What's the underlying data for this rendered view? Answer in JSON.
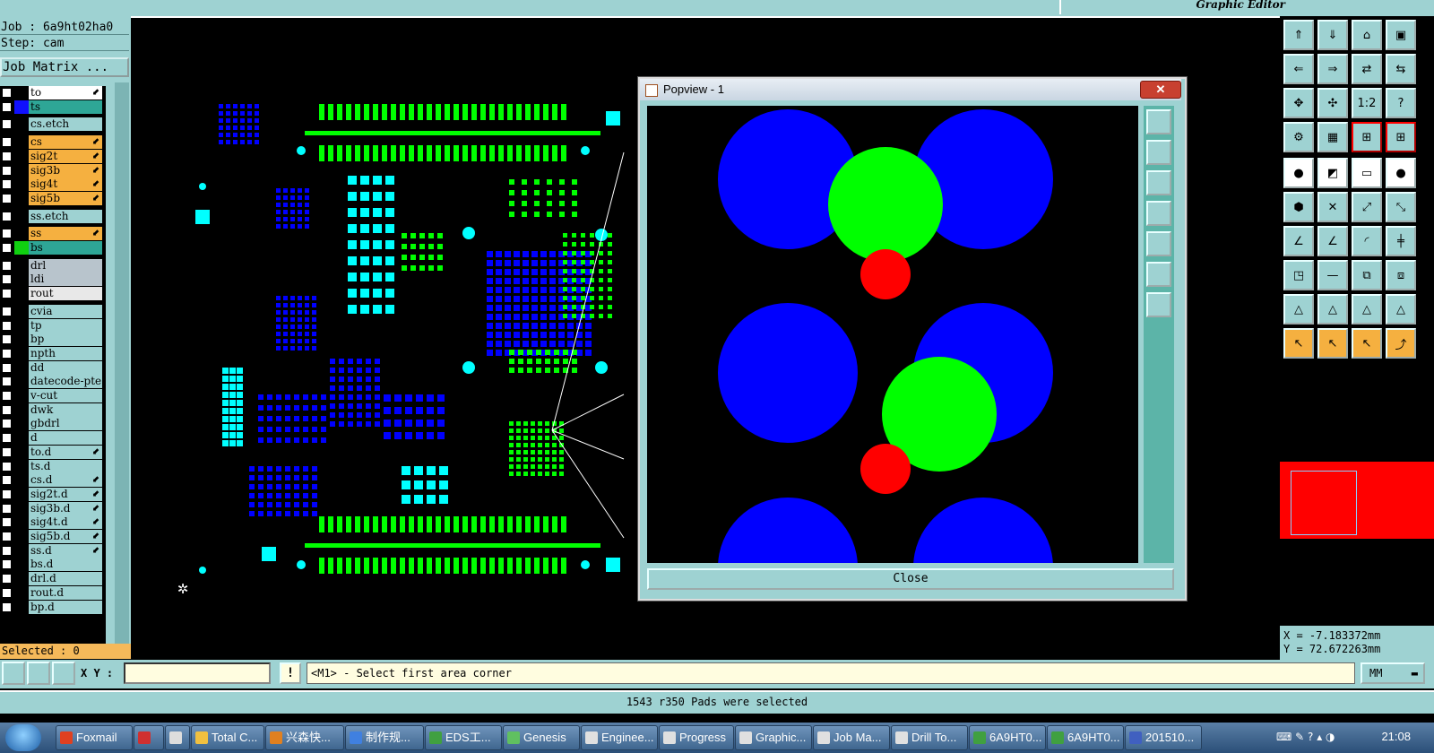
{
  "app": {
    "subtitle": "Graphic Editor"
  },
  "job": {
    "job_line": "Job : 6a9ht02ha0",
    "step_line": "Step: cam",
    "matrix_button": "Job Matrix ..."
  },
  "layers": [
    {
      "name": "to",
      "color": "#ffffff",
      "bg": "#ffffff",
      "flag": "⬋",
      "swatch": "#000000"
    },
    {
      "name": "ts",
      "color": "#2ea696",
      "bg": "#2ea696",
      "flag": "",
      "swatch": "#1010ff"
    },
    {
      "name": "cs.etch",
      "color": "#9ed2d2",
      "bg": "#9ed2d2",
      "flag": "",
      "swatch": "#000000"
    },
    {
      "name": "cs",
      "color": "#f5b040",
      "bg": "#f5b040",
      "flag": "⬋",
      "swatch": "#000000"
    },
    {
      "name": "sig2t",
      "color": "#f5b040",
      "bg": "#f5b040",
      "flag": "⬋",
      "swatch": "#000000"
    },
    {
      "name": "sig3b",
      "color": "#f5b040",
      "bg": "#f5b040",
      "flag": "⬋",
      "swatch": "#000000"
    },
    {
      "name": "sig4t",
      "color": "#f5b040",
      "bg": "#f5b040",
      "flag": "⬋",
      "swatch": "#000000"
    },
    {
      "name": "sig5b",
      "color": "#f5b040",
      "bg": "#f5b040",
      "flag": "⬋",
      "swatch": "#000000"
    },
    {
      "name": "ss.etch",
      "color": "#9ed2d2",
      "bg": "#9ed2d2",
      "flag": "",
      "swatch": "#000000"
    },
    {
      "name": "ss",
      "color": "#f5b040",
      "bg": "#f5b040",
      "flag": "⬋",
      "swatch": "#000000"
    },
    {
      "name": "bs",
      "color": "#2ea696",
      "bg": "#2ea696",
      "flag": "",
      "swatch": "#10d010"
    },
    {
      "name": "drl",
      "color": "#b8c4cc",
      "bg": "#b8c4cc",
      "flag": "",
      "swatch": "#000000"
    },
    {
      "name": "ldi",
      "color": "#b8c4cc",
      "bg": "#b8c4cc",
      "flag": "",
      "swatch": "#000000"
    },
    {
      "name": "rout",
      "color": "#e8e8e8",
      "bg": "#e8e8e8",
      "flag": "",
      "swatch": "#000000"
    },
    {
      "name": "cvia",
      "color": "#9ed2d2",
      "bg": "#9ed2d2",
      "flag": "",
      "swatch": "#000000"
    },
    {
      "name": "tp",
      "color": "#9ed2d2",
      "bg": "#9ed2d2",
      "flag": "",
      "swatch": "#000000"
    },
    {
      "name": "bp",
      "color": "#9ed2d2",
      "bg": "#9ed2d2",
      "flag": "",
      "swatch": "#000000"
    },
    {
      "name": "npth",
      "color": "#9ed2d2",
      "bg": "#9ed2d2",
      "flag": "",
      "swatch": "#000000"
    },
    {
      "name": "dd",
      "color": "#9ed2d2",
      "bg": "#9ed2d2",
      "flag": "",
      "swatch": "#000000"
    },
    {
      "name": "datecode-pte",
      "color": "#9ed2d2",
      "bg": "#9ed2d2",
      "flag": "",
      "swatch": "#000000"
    },
    {
      "name": "v-cut",
      "color": "#9ed2d2",
      "bg": "#9ed2d2",
      "flag": "",
      "swatch": "#000000"
    },
    {
      "name": "dwk",
      "color": "#9ed2d2",
      "bg": "#9ed2d2",
      "flag": "",
      "swatch": "#000000"
    },
    {
      "name": "gbdrl",
      "color": "#9ed2d2",
      "bg": "#9ed2d2",
      "flag": "",
      "swatch": "#000000"
    },
    {
      "name": "d",
      "color": "#9ed2d2",
      "bg": "#9ed2d2",
      "flag": "",
      "swatch": "#000000"
    },
    {
      "name": "to.d",
      "color": "#9ed2d2",
      "bg": "#9ed2d2",
      "flag": "⬋",
      "swatch": "#000000"
    },
    {
      "name": "ts.d",
      "color": "#9ed2d2",
      "bg": "#9ed2d2",
      "flag": "",
      "swatch": "#000000"
    },
    {
      "name": "cs.d",
      "color": "#9ed2d2",
      "bg": "#9ed2d2",
      "flag": "⬋",
      "swatch": "#000000"
    },
    {
      "name": "sig2t.d",
      "color": "#9ed2d2",
      "bg": "#9ed2d2",
      "flag": "⬋",
      "swatch": "#000000"
    },
    {
      "name": "sig3b.d",
      "color": "#9ed2d2",
      "bg": "#9ed2d2",
      "flag": "⬋",
      "swatch": "#000000"
    },
    {
      "name": "sig4t.d",
      "color": "#9ed2d2",
      "bg": "#9ed2d2",
      "flag": "⬋",
      "swatch": "#000000"
    },
    {
      "name": "sig5b.d",
      "color": "#9ed2d2",
      "bg": "#9ed2d2",
      "flag": "⬋",
      "swatch": "#000000"
    },
    {
      "name": "ss.d",
      "color": "#9ed2d2",
      "bg": "#9ed2d2",
      "flag": "⬋",
      "swatch": "#000000"
    },
    {
      "name": "bs.d",
      "color": "#9ed2d2",
      "bg": "#9ed2d2",
      "flag": "",
      "swatch": "#000000"
    },
    {
      "name": "drl.d",
      "color": "#9ed2d2",
      "bg": "#9ed2d2",
      "flag": "",
      "swatch": "#000000"
    },
    {
      "name": "rout.d",
      "color": "#9ed2d2",
      "bg": "#9ed2d2",
      "flag": "",
      "swatch": "#000000"
    },
    {
      "name": "bp.d",
      "color": "#9ed2d2",
      "bg": "#9ed2d2",
      "flag": "",
      "swatch": "#000000"
    }
  ],
  "selected_text": "Selected : 0",
  "popup": {
    "title": "Popview - 1",
    "close_x": "✕",
    "close_label": "Close"
  },
  "coords": {
    "x": "X = -7.183372mm",
    "y": "Y = 72.672263mm"
  },
  "command": {
    "xy_label": "X Y :",
    "xy_value": "",
    "bang": "!",
    "prompt": "<M1> - Select first area corner",
    "units": "MM"
  },
  "status": "1543 r350 Pads were selected",
  "taskbar": {
    "items": [
      {
        "label": "Foxmail",
        "color": "#e04020"
      },
      {
        "label": "",
        "color": "#d03030"
      },
      {
        "label": "",
        "color": "#dddddd"
      },
      {
        "label": "Total C...",
        "color": "#f0c040"
      },
      {
        "label": "兴森快...",
        "color": "#e08020"
      },
      {
        "label": "制作规...",
        "color": "#4080e0"
      },
      {
        "label": "EDS工...",
        "color": "#40a040"
      },
      {
        "label": "Genesis",
        "color": "#60c060"
      },
      {
        "label": "Enginee...",
        "color": "#e0e0e0"
      },
      {
        "label": "Progress",
        "color": "#e0e0e0"
      },
      {
        "label": "Graphic...",
        "color": "#e0e0e0"
      },
      {
        "label": "Job Ma...",
        "color": "#e0e0e0"
      },
      {
        "label": "Drill To...",
        "color": "#e0e0e0"
      },
      {
        "label": "6A9HT0...",
        "color": "#40a040"
      },
      {
        "label": "6A9HT0...",
        "color": "#40a040"
      },
      {
        "label": "201510...",
        "color": "#4060c0"
      }
    ],
    "tray": "⌨ ✎ ? ▴ ◑",
    "clock": "21:08"
  },
  "colors": {
    "panel": "#9ed2d2",
    "pad_blue": "#0000ff",
    "pad_green": "#00ff00",
    "pad_cyan": "#00ffff",
    "red": "#ff0000"
  }
}
